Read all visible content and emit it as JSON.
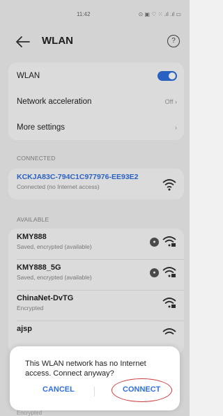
{
  "status_bar": {
    "time": "11:42",
    "indicators": "⊙ ▣ ♡ ⁙ .ıl .ıl ▭"
  },
  "header": {
    "title": "WLAN",
    "help_icon": "?"
  },
  "settings": {
    "wlan_label": "WLAN",
    "wlan_enabled": true,
    "network_acceleration_label": "Network acceleration",
    "network_acceleration_value": "Off",
    "more_settings_label": "More settings"
  },
  "connected": {
    "section_label": "CONNECTED",
    "network_name": "KCKJA83C-794C1C977976-EE93E2",
    "network_status": "Connected (no Internet access)"
  },
  "available": {
    "section_label": "AVAILABLE",
    "networks": [
      {
        "name": "KMY888",
        "status": "Saved, encrypted (available)"
      },
      {
        "name": "KMY888_5G",
        "status": "Saved, encrypted (available)"
      },
      {
        "name": "ChinaNet-DvTG",
        "status": "Encrypted"
      },
      {
        "name": "ajsp",
        "status": ""
      }
    ],
    "hidden_under_dialog": "Encrypted"
  },
  "dialog": {
    "message": "This WLAN network has no Internet access. Connect anyway?",
    "cancel_label": "CANCEL",
    "connect_label": "CONNECT"
  },
  "colors": {
    "accent": "#2f6fdf",
    "highlight": "#d23b3b"
  }
}
